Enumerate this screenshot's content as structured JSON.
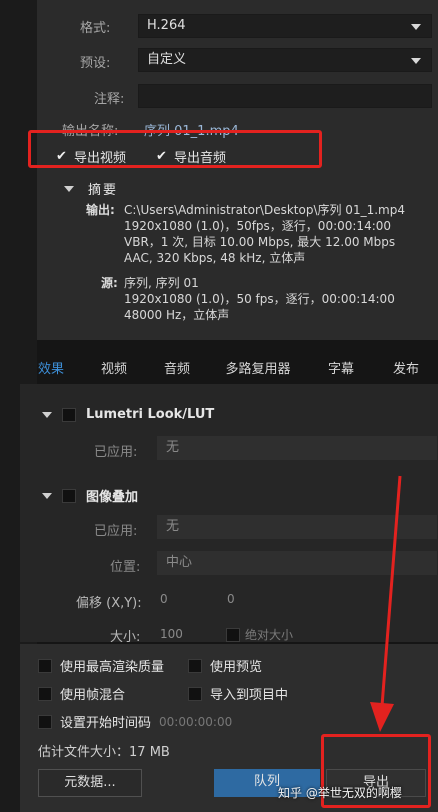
{
  "export_settings": {
    "format_label": "格式:",
    "format_value": "H.264",
    "preset_label": "预设:",
    "preset_value": "自定义",
    "comment_label": "注释:",
    "output_name_label": "输出名称:",
    "output_name_value": "序列 01_1.mp4",
    "export_video_label": "导出视频",
    "export_audio_label": "导出音频"
  },
  "summary": {
    "title": "摘要",
    "output_label": "输出:",
    "output_lines": [
      "C:\\Users\\Administrator\\Desktop\\序列 01_1.mp4",
      "1920x1080 (1.0)，50fps，逐行，00:00:14:00",
      "VBR，1 次, 目标 10.00 Mbps, 最大 12.00 Mbps",
      "AAC, 320 Kbps, 48  kHz, 立体声"
    ],
    "source_label": "源:",
    "source_lines": [
      "序列, 序列 01",
      "1920x1080 (1.0)，50 fps，逐行，00:00:14:00",
      "48000 Hz，立体声"
    ]
  },
  "tabs": [
    "效果",
    "视频",
    "音频",
    "多路复用器",
    "字幕",
    "发布"
  ],
  "effects": {
    "lumetri_title": "Lumetri Look/LUT",
    "lumetri_applied_label": "已应用:",
    "lumetri_applied_value": "无",
    "overlay_title": "图像叠加",
    "overlay_applied_label": "已应用:",
    "overlay_applied_value": "无",
    "position_label": "位置:",
    "position_value": "中心",
    "offset_label": "偏移 (X,Y):",
    "offset_x": "0",
    "offset_y": "0",
    "size_label": "大小:",
    "size_value": "100",
    "absolute_size_label": "绝对大小"
  },
  "options": {
    "max_render_quality": "使用最高渲染质量",
    "use_previews": "使用预览",
    "frame_blending": "使用帧混合",
    "import_into_project": "导入到项目中",
    "set_start_timecode": "设置开始时间码",
    "start_timecode_value": "00:00:00:00",
    "estimated_size_label": "估计文件大小：",
    "estimated_size_value": "17 MB"
  },
  "buttons": {
    "metadata": "元数据...",
    "queue": "队列",
    "export": "导出"
  },
  "watermark": "知乎 @举世无双的啊樱",
  "colors": {
    "accent_blue": "#3d8fd8",
    "annotation_red": "#e3221f",
    "queue_button": "#2e6aa2"
  }
}
